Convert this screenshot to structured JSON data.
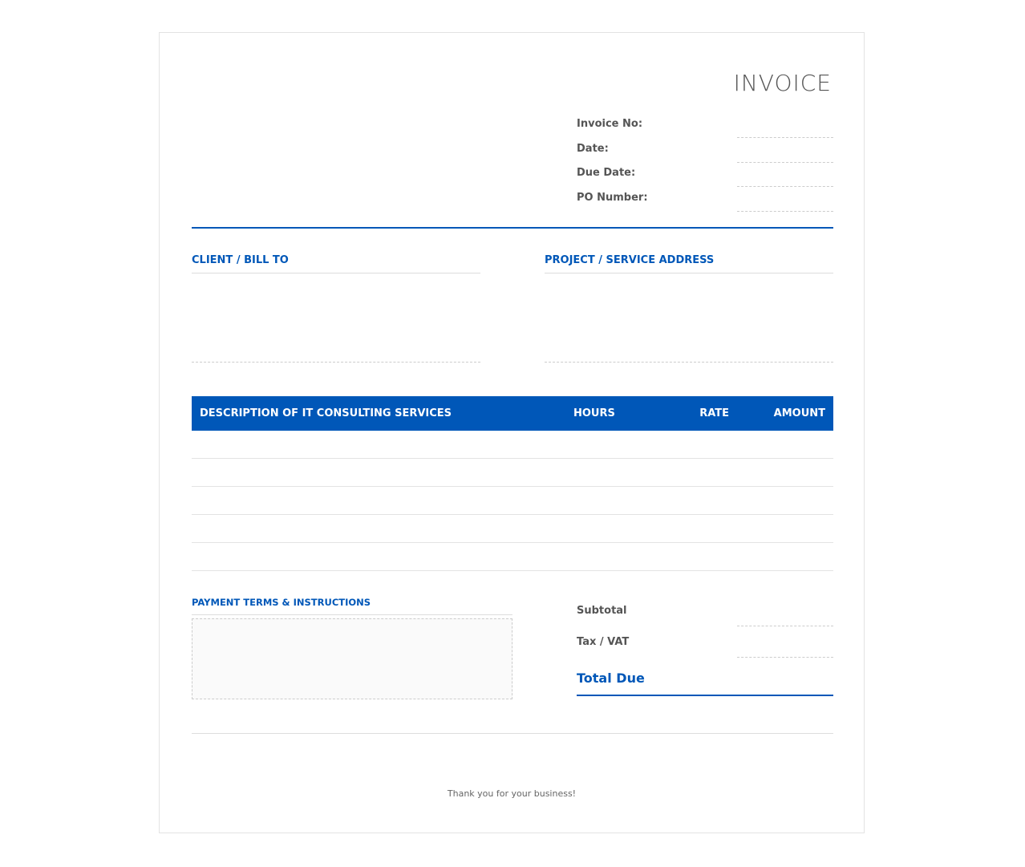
{
  "header": {
    "title": "INVOICE",
    "fields": [
      {
        "label": "Invoice No:",
        "value": ""
      },
      {
        "label": "Date:",
        "value": ""
      },
      {
        "label": "Due Date:",
        "value": ""
      },
      {
        "label": "PO Number:",
        "value": ""
      }
    ]
  },
  "addresses": {
    "client_heading": "CLIENT / BILL TO",
    "client_value": "",
    "project_heading": "PROJECT / SERVICE ADDRESS",
    "project_value": ""
  },
  "items": {
    "columns": [
      "DESCRIPTION OF IT CONSULTING SERVICES",
      "HOURS",
      "RATE",
      "AMOUNT"
    ],
    "rows": [
      {
        "description": "",
        "hours": "",
        "rate": "",
        "amount": ""
      },
      {
        "description": "",
        "hours": "",
        "rate": "",
        "amount": ""
      },
      {
        "description": "",
        "hours": "",
        "rate": "",
        "amount": ""
      },
      {
        "description": "",
        "hours": "",
        "rate": "",
        "amount": ""
      },
      {
        "description": "",
        "hours": "",
        "rate": "",
        "amount": ""
      }
    ]
  },
  "payment": {
    "heading": "PAYMENT TERMS & INSTRUCTIONS",
    "value": ""
  },
  "totals": {
    "subtotal_label": "Subtotal",
    "subtotal_value": "",
    "tax_label": "Tax / VAT",
    "tax_value": "",
    "total_label": "Total Due",
    "total_value": ""
  },
  "footer": {
    "text": "Thank you for your business!"
  },
  "colors": {
    "accent": "#0057b8",
    "text": "#555555",
    "rule": "#dddddd"
  }
}
